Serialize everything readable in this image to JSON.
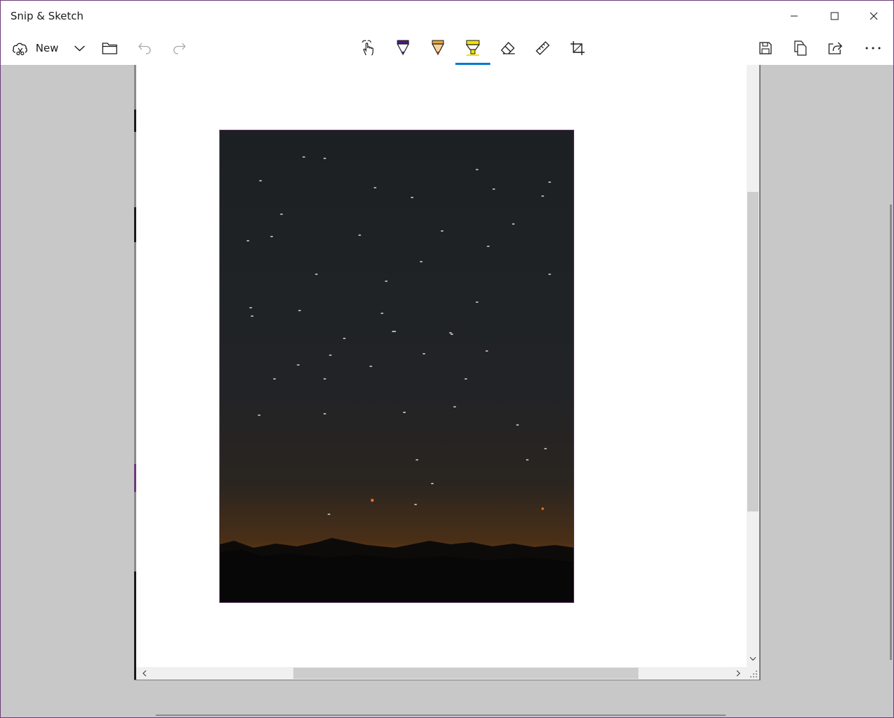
{
  "window": {
    "title": "Snip & Sketch",
    "accent_color": "#0078d4",
    "controls": {
      "minimize": "minimize-icon",
      "maximize": "maximize-icon",
      "close": "close-icon"
    }
  },
  "toolbar": {
    "new_label": "New",
    "left_tools": [
      {
        "name": "new-snip",
        "icon": "snip-icon"
      },
      {
        "name": "new-options",
        "icon": "chevron-down-icon"
      },
      {
        "name": "open-file",
        "icon": "folder-icon"
      },
      {
        "name": "undo",
        "icon": "undo-icon",
        "enabled": false
      },
      {
        "name": "redo",
        "icon": "redo-icon",
        "enabled": false
      }
    ],
    "center_tools": [
      {
        "name": "touch-writing",
        "icon": "touch-writing-icon"
      },
      {
        "name": "ballpoint-pen",
        "icon": "pen-icon",
        "color": "#4b1b82"
      },
      {
        "name": "pencil",
        "icon": "pencil-icon",
        "color": "#e8a33a"
      },
      {
        "name": "highlighter",
        "icon": "highlighter-icon",
        "color": "#f5e000",
        "selected": true
      },
      {
        "name": "eraser",
        "icon": "eraser-icon"
      },
      {
        "name": "ruler",
        "icon": "ruler-icon"
      },
      {
        "name": "crop",
        "icon": "crop-icon"
      }
    ],
    "right_tools": [
      {
        "name": "save",
        "icon": "save-icon"
      },
      {
        "name": "copy",
        "icon": "copy-icon"
      },
      {
        "name": "share",
        "icon": "share-icon"
      },
      {
        "name": "more",
        "icon": "more-icon"
      }
    ]
  }
}
